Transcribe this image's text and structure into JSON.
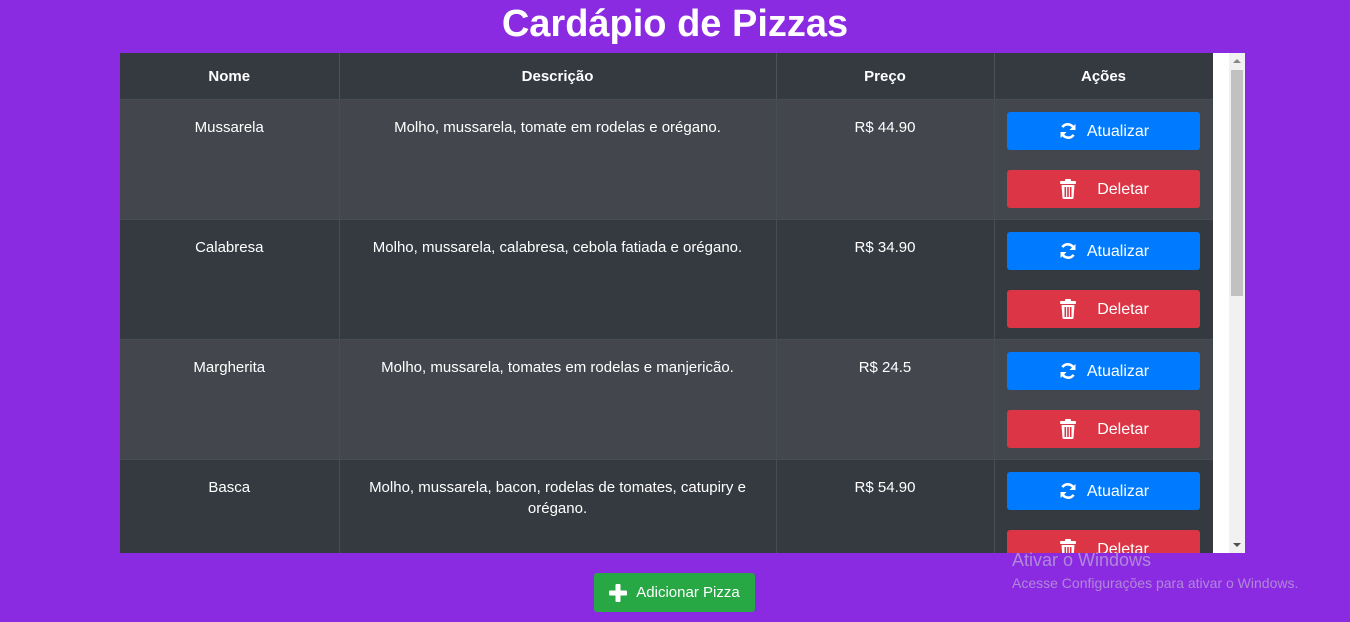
{
  "page": {
    "title": "Cardápio de Pizzas",
    "background_color": "#8a2be2"
  },
  "table": {
    "headers": [
      "Nome",
      "Descrição",
      "Preço",
      "Ações"
    ],
    "rows": [
      {
        "name": "Mussarela",
        "description": "Molho, mussarela, tomate em rodelas e orégano.",
        "price": "R$ 44.90"
      },
      {
        "name": "Calabresa",
        "description": "Molho, mussarela, calabresa, cebola fatiada e orégano.",
        "price": "R$ 34.90"
      },
      {
        "name": "Margherita",
        "description": "Molho, mussarela, tomates em rodelas e manjericão.",
        "price": "R$ 24.5"
      },
      {
        "name": "Basca",
        "description": "Molho, mussarela, bacon, rodelas de tomates, catupiry e orégano.",
        "price": "R$ 54.90"
      }
    ],
    "update_label": "Atualizar",
    "delete_label": "Deletar",
    "update_icon": "refresh-icon",
    "delete_icon": "trash-icon"
  },
  "add_button": {
    "label": "Adicionar Pizza",
    "icon": "plus-icon"
  },
  "watermark": {
    "title": "Ativar o Windows",
    "subtitle": "Acesse Configurações para ativar o Windows."
  },
  "colors": {
    "update": "#007bff",
    "delete": "#dc3545",
    "add": "#28a745",
    "table_dark": "#343a40",
    "table_stripe": "#43474d"
  }
}
